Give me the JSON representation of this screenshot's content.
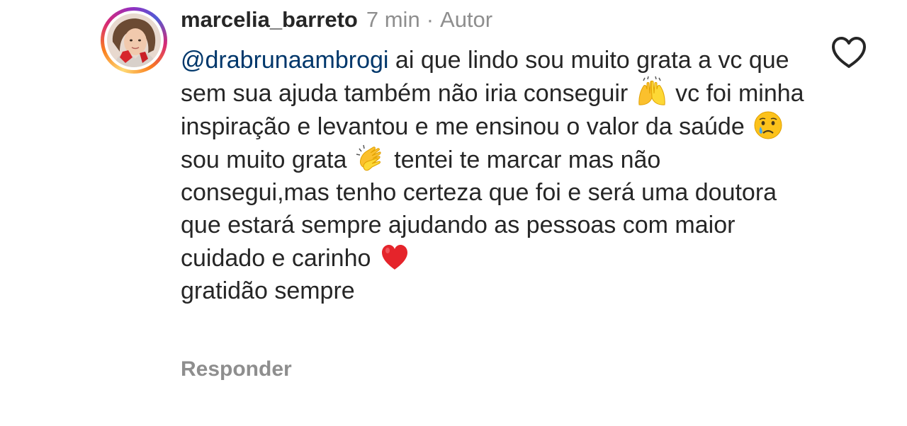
{
  "comment": {
    "username": "marcelia_barreto",
    "time": "7 min",
    "separator": "·",
    "role": "Autor",
    "mention": "@drabrunaambrogi",
    "text_1": "ai que lindo sou muito grata a vc que sem sua ajuda também não iria conseguir",
    "emoji_1": "🙌",
    "text_2": "vc foi minha inspiração e levantou e me ensinou o valor da saúde",
    "emoji_2": "😢",
    "text_3": "sou muito grata",
    "emoji_3": "👏",
    "text_4": "tentei te marcar mas não consegui,mas tenho certeza que foi e será uma doutora que estará sempre ajudando as pessoas com maior cuidado e carinho",
    "emoji_4": "❤️",
    "text_5": "gratidão sempre",
    "reply_label": "Responder"
  },
  "icons": {
    "avatar": "user-avatar-photo",
    "like": "heart-outline-icon"
  },
  "colors": {
    "mention": "#00376b",
    "text": "#262626",
    "secondary": "#8e8e8e",
    "heart": "#e5242b"
  }
}
